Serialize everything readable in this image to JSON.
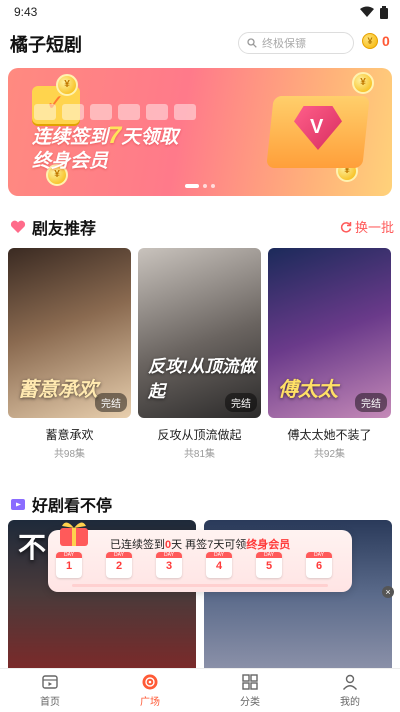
{
  "status": {
    "time": "9:43"
  },
  "header": {
    "title": "橘子短剧",
    "search_placeholder": "终极保镖",
    "coin_count": "0"
  },
  "banner": {
    "line1_pre": "连续签到",
    "line1_highlight": "7",
    "line1_post": "天领取",
    "line2": "终身会员",
    "coin_glyph": "¥",
    "gem_letter": "V"
  },
  "recommend": {
    "title": "剧友推荐",
    "refresh_label": "换一批",
    "items": [
      {
        "title": "蓄意承欢",
        "episodes": "共98集",
        "badge": "完结",
        "poster_text": "蓄意承欢"
      },
      {
        "title": "反攻从顶流做起",
        "episodes": "共81集",
        "badge": "完结",
        "poster_text": "反攻!从顶流做起"
      },
      {
        "title": "傅太太她不装了",
        "episodes": "共92集",
        "badge": "完结",
        "poster_text": "傅太太"
      }
    ]
  },
  "feed": {
    "title": "好剧看不停",
    "first_poster_text": "不败战神"
  },
  "checkin": {
    "text_pre": "已连续签到",
    "streak_days": "0",
    "text_mid": "天 再签",
    "remaining_days": "7",
    "text_post": "天可领",
    "reward": "终身会员",
    "day_label": "DAY",
    "days": [
      "1",
      "2",
      "3",
      "4",
      "5",
      "6"
    ],
    "close_glyph": "×"
  },
  "tabs": [
    {
      "label": "首页",
      "icon": "video-icon"
    },
    {
      "label": "广场",
      "icon": "play-circle-icon",
      "active": true
    },
    {
      "label": "分类",
      "icon": "grid-icon"
    },
    {
      "label": "我的",
      "icon": "user-icon"
    }
  ],
  "colors": {
    "accent": "#ff5a36",
    "checkin_red": "#ff3b3b"
  }
}
